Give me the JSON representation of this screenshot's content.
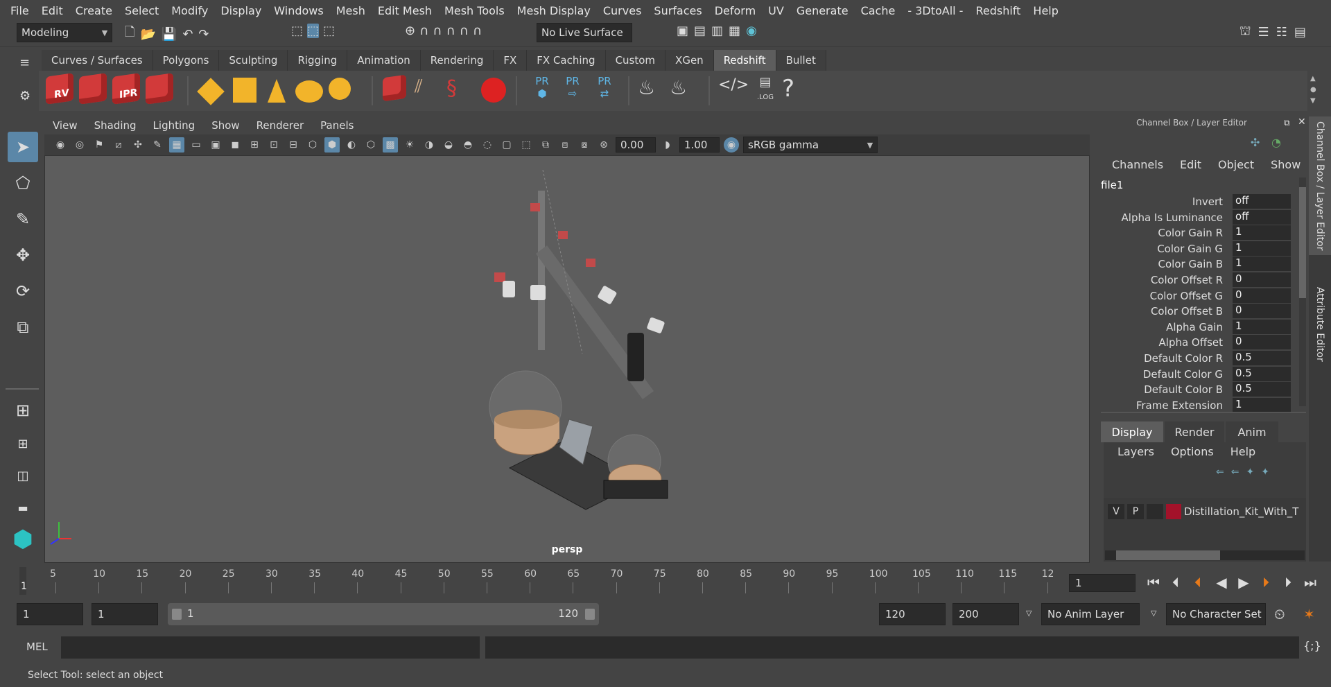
{
  "menu": [
    "File",
    "Edit",
    "Create",
    "Select",
    "Modify",
    "Display",
    "Windows",
    "Mesh",
    "Edit Mesh",
    "Mesh Tools",
    "Mesh Display",
    "Curves",
    "Surfaces",
    "Deform",
    "UV",
    "Generate",
    "Cache",
    "- 3DtoAll -",
    "Redshift",
    "Help"
  ],
  "status": {
    "mode": "Modeling",
    "live_surface": "No Live Surface"
  },
  "shelf_tabs": [
    "Curves / Surfaces",
    "Polygons",
    "Sculpting",
    "Rigging",
    "Animation",
    "Rendering",
    "FX",
    "FX Caching",
    "Custom",
    "XGen",
    "Redshift",
    "Bullet"
  ],
  "active_shelf_tab": "Redshift",
  "shelf_labels": {
    "rv": "RV",
    "ipr": "IPR",
    "pr": "PR",
    "log": ".LOG",
    "help": "?"
  },
  "viewport": {
    "menu": [
      "View",
      "Shading",
      "Lighting",
      "Show",
      "Renderer",
      "Panels"
    ],
    "exposure": "0.00",
    "gamma": "1.00",
    "color_space": "sRGB gamma",
    "camera": "persp"
  },
  "channel_box": {
    "title": "Channel Box / Layer Editor",
    "menu": [
      "Channels",
      "Edit",
      "Object",
      "Show"
    ],
    "node": "file1",
    "channels": [
      {
        "label": "Invert",
        "value": "off"
      },
      {
        "label": "Alpha Is Luminance",
        "value": "off"
      },
      {
        "label": "Color Gain R",
        "value": "1"
      },
      {
        "label": "Color Gain G",
        "value": "1"
      },
      {
        "label": "Color Gain B",
        "value": "1"
      },
      {
        "label": "Color Offset R",
        "value": "0"
      },
      {
        "label": "Color Offset G",
        "value": "0"
      },
      {
        "label": "Color Offset B",
        "value": "0"
      },
      {
        "label": "Alpha Gain",
        "value": "1"
      },
      {
        "label": "Alpha Offset",
        "value": "0"
      },
      {
        "label": "Default Color R",
        "value": "0.5"
      },
      {
        "label": "Default Color G",
        "value": "0.5"
      },
      {
        "label": "Default Color B",
        "value": "0.5"
      },
      {
        "label": "Frame Extension",
        "value": "1"
      }
    ],
    "layer_tabs": [
      "Display",
      "Render",
      "Anim"
    ],
    "layer_menu": [
      "Layers",
      "Options",
      "Help"
    ],
    "layer": {
      "v": "V",
      "p": "P",
      "name": "Distillation_Kit_With_T",
      "color": "#a3122a"
    }
  },
  "side_tabs": [
    "Channel Box / Layer Editor",
    "Attribute Editor"
  ],
  "timeline": {
    "ticks": [
      "5",
      "10",
      "15",
      "20",
      "25",
      "30",
      "35",
      "40",
      "45",
      "50",
      "55",
      "60",
      "65",
      "70",
      "75",
      "80",
      "85",
      "90",
      "95",
      "100",
      "105",
      "110",
      "115",
      "12"
    ],
    "current_marker": "1",
    "current_frame": "1"
  },
  "range": {
    "start": "1",
    "anim_start": "1",
    "slider_start": "1",
    "slider_end": "120",
    "anim_end": "120",
    "end": "200",
    "anim_layer": "No Anim Layer",
    "character_set": "No Character Set"
  },
  "command": {
    "lang": "MEL"
  },
  "help_line": "Select Tool: select an object"
}
